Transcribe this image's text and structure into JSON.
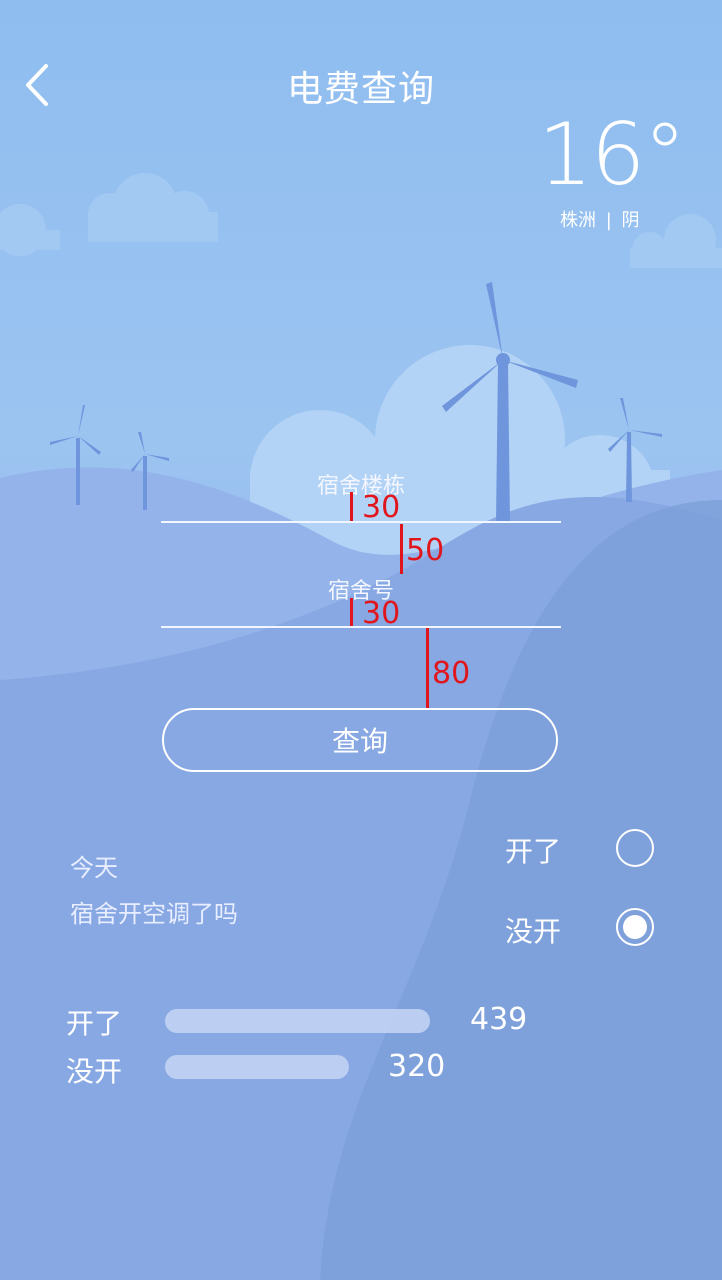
{
  "header": {
    "title": "电费查询",
    "back_icon": "chevron-left-icon"
  },
  "weather": {
    "temperature": "16°",
    "location": "株洲",
    "separator": "|",
    "condition": "阴"
  },
  "form": {
    "building_label": "宿舍楼栋",
    "room_label": "宿舍号",
    "query_button": "查询",
    "annotations": {
      "building_gap": "30",
      "between_fields": "50",
      "room_gap": "30",
      "to_button": "80"
    }
  },
  "survey": {
    "question_line1": "今天",
    "question_line2": "宿舍开空调了吗",
    "options": [
      {
        "label": "开了",
        "selected": false
      },
      {
        "label": "没开",
        "selected": true
      }
    ]
  },
  "stats": [
    {
      "label": "开了",
      "value": "439"
    },
    {
      "label": "没开",
      "value": "320"
    }
  ],
  "colors": {
    "accent_annotation": "#e0161c",
    "text": "#ffffff"
  }
}
